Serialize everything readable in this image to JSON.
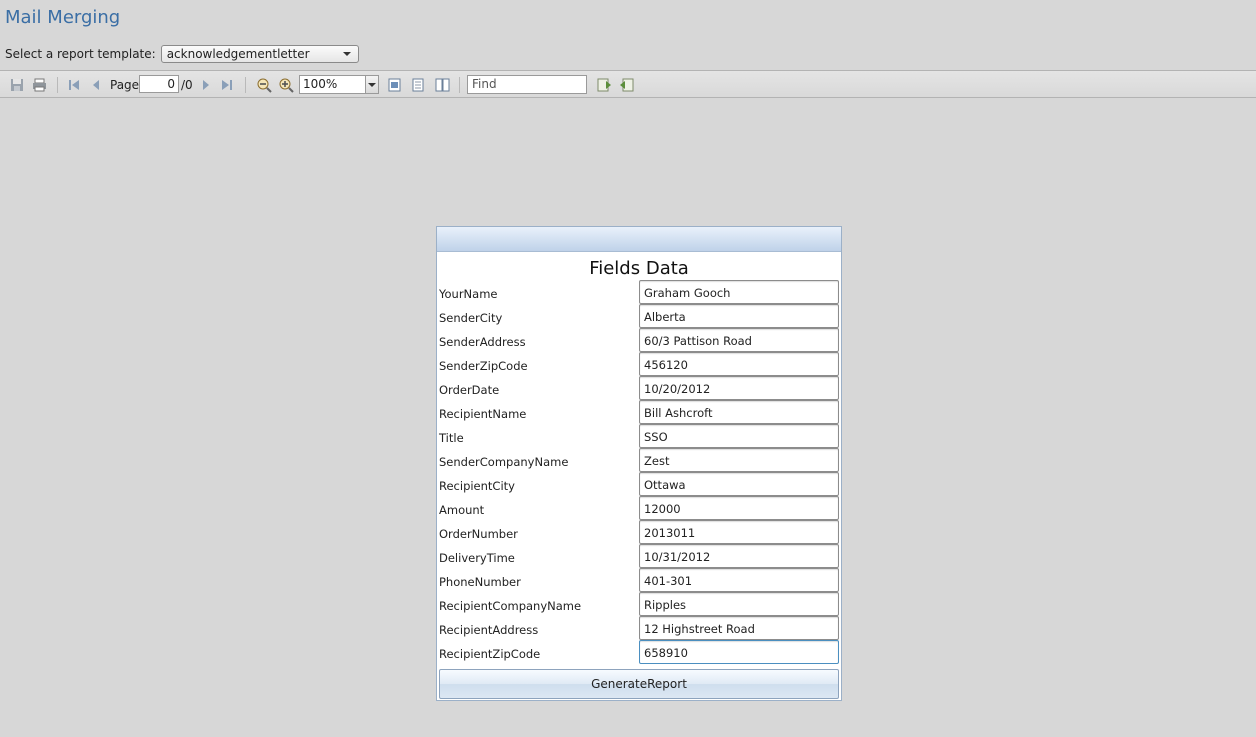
{
  "page": {
    "title": "Mail Merging"
  },
  "template": {
    "label": "Select a report template:",
    "selected": "acknowledgementletter"
  },
  "toolbar": {
    "icons": [
      "save-icon",
      "print-icon",
      "first-page-icon",
      "prev-page-icon",
      "next-page-icon",
      "last-page-icon",
      "zoom-out-icon",
      "zoom-in-icon",
      "fit-page-icon",
      "single-page-icon",
      "two-page-icon",
      "find-prev-icon",
      "find-next-icon"
    ],
    "page_label": "Page",
    "page_current": "0",
    "page_total": "/0",
    "zoom": "100%",
    "find_placeholder": "Find"
  },
  "panel": {
    "title": "Fields Data",
    "fields": [
      {
        "label": "YourName",
        "value": "Graham Gooch"
      },
      {
        "label": "SenderCity",
        "value": "Alberta"
      },
      {
        "label": "SenderAddress",
        "value": "60/3 Pattison Road"
      },
      {
        "label": "SenderZipCode",
        "value": "456120"
      },
      {
        "label": "OrderDate",
        "value": "10/20/2012"
      },
      {
        "label": "RecipientName",
        "value": "Bill Ashcroft"
      },
      {
        "label": "Title",
        "value": "SSO"
      },
      {
        "label": "SenderCompanyName",
        "value": "Zest"
      },
      {
        "label": "RecipientCity",
        "value": "Ottawa"
      },
      {
        "label": "Amount",
        "value": "12000"
      },
      {
        "label": "OrderNumber",
        "value": "2013011"
      },
      {
        "label": "DeliveryTime",
        "value": "10/31/2012"
      },
      {
        "label": "PhoneNumber",
        "value": "401-301"
      },
      {
        "label": "RecipientCompanyName",
        "value": "Ripples"
      },
      {
        "label": "RecipientAddress",
        "value": "12 Highstreet Road"
      },
      {
        "label": "RecipientZipCode",
        "value": "658910"
      }
    ],
    "button_label": "GenerateReport"
  },
  "colors": {
    "title": "#3a6ea5",
    "background": "#d7d7d7",
    "panel_header": "#bfd2e9"
  }
}
